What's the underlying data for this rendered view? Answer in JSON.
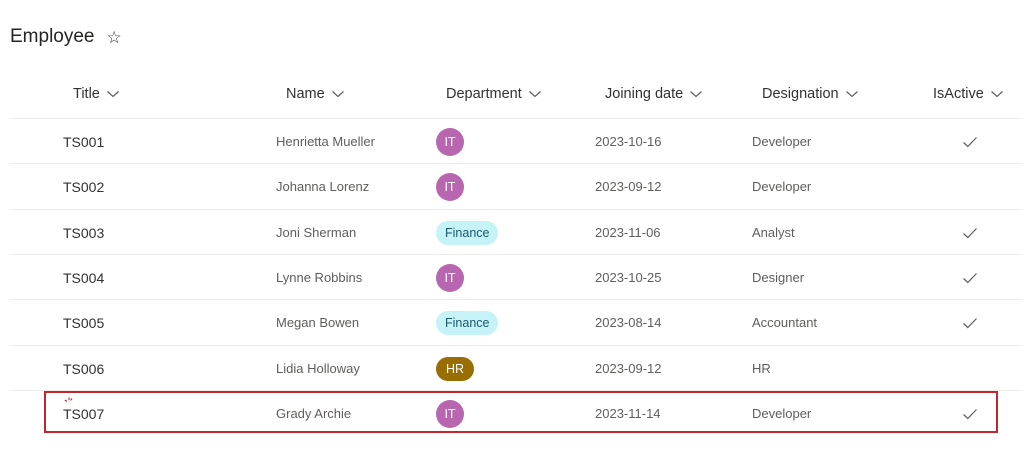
{
  "list": {
    "title": "Employee",
    "favorite_icon": "star-outline-icon"
  },
  "columns": [
    {
      "key": "title",
      "label": "Title"
    },
    {
      "key": "name",
      "label": "Name"
    },
    {
      "key": "department",
      "label": "Department"
    },
    {
      "key": "joining_date",
      "label": "Joining date"
    },
    {
      "key": "designation",
      "label": "Designation"
    },
    {
      "key": "isactive",
      "label": "IsActive"
    }
  ],
  "departments": {
    "IT": {
      "bg": "#b866b0",
      "fg": "#ffffff"
    },
    "Finance": {
      "bg": "#c5f3f7",
      "fg": "#1c5a6b"
    },
    "HR": {
      "bg": "#986d02",
      "fg": "#ffffff"
    }
  },
  "rows": [
    {
      "title": "TS001",
      "name": "Henrietta Mueller",
      "department": "IT",
      "joining_date": "2023-10-16",
      "designation": "Developer",
      "isactive": true
    },
    {
      "title": "TS002",
      "name": "Johanna Lorenz",
      "department": "IT",
      "joining_date": "2023-09-12",
      "designation": "Developer",
      "isactive": false
    },
    {
      "title": "TS003",
      "name": "Joni Sherman",
      "department": "Finance",
      "joining_date": "2023-11-06",
      "designation": "Analyst",
      "isactive": true
    },
    {
      "title": "TS004",
      "name": "Lynne Robbins",
      "department": "IT",
      "joining_date": "2023-10-25",
      "designation": "Designer",
      "isactive": true
    },
    {
      "title": "TS005",
      "name": "Megan Bowen",
      "department": "Finance",
      "joining_date": "2023-08-14",
      "designation": "Accountant",
      "isactive": true
    },
    {
      "title": "TS006",
      "name": "Lidia Holloway",
      "department": "HR",
      "joining_date": "2023-09-12",
      "designation": "HR",
      "isactive": false
    },
    {
      "title": "TS007",
      "name": "Grady Archie",
      "department": "IT",
      "joining_date": "2023-11-14",
      "designation": "Developer",
      "isactive": true
    }
  ],
  "highlight": {
    "row_title": "TS007",
    "color": "#c4262e",
    "icon": "loading-spinner-icon"
  }
}
